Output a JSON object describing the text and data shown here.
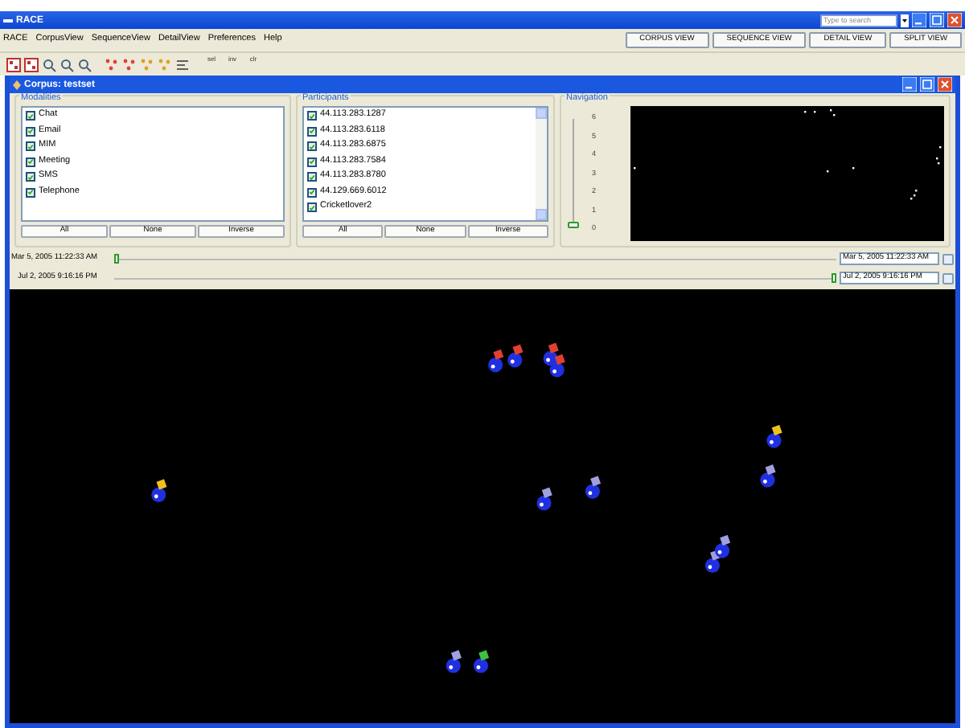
{
  "window": {
    "title": "RACE"
  },
  "search": {
    "placeholder": "Type to search"
  },
  "menu": [
    "RACE",
    "CorpusView",
    "SequenceView",
    "DetailView",
    "Preferences",
    "Help"
  ],
  "view_buttons": [
    "CORPUS VIEW",
    "SEQUENCE VIEW",
    "DETAIL VIEW",
    "SPLIT VIEW"
  ],
  "toolbar_labels": [
    "sel",
    "inv",
    "clr"
  ],
  "corpus_frame": {
    "title": "Corpus: testset"
  },
  "modalities": {
    "title": "Modalities",
    "items": [
      {
        "label": "Chat",
        "checked": true
      },
      {
        "label": "Email",
        "checked": true
      },
      {
        "label": "MIM",
        "checked": true
      },
      {
        "label": "Meeting",
        "checked": true
      },
      {
        "label": "SMS",
        "checked": true
      },
      {
        "label": "Telephone",
        "checked": true
      }
    ],
    "buttons": [
      "All",
      "None",
      "Inverse"
    ]
  },
  "participants": {
    "title": "Participants",
    "items": [
      {
        "label": "44.113.283.1287",
        "checked": true
      },
      {
        "label": "44.113.283.6118",
        "checked": true
      },
      {
        "label": "44.113.283.6875",
        "checked": true
      },
      {
        "label": "44.113.283.7584",
        "checked": true
      },
      {
        "label": "44.113.283.8780",
        "checked": true
      },
      {
        "label": "44.129.669.6012",
        "checked": true
      },
      {
        "label": "Cricketlover2",
        "checked": true
      }
    ],
    "buttons": [
      "All",
      "None",
      "Inverse"
    ]
  },
  "navigation": {
    "title": "Navigation",
    "scale": [
      "6",
      "5",
      "4",
      "3",
      "2",
      "1",
      "0"
    ],
    "level": 0
  },
  "time_range": [
    {
      "label": "Mar 5, 2005 11:22:33 AM",
      "field": "Mar 5, 2005 11:22:33 AM",
      "level": 0
    },
    {
      "label": "Jul 2, 2005 9:16:16 PM",
      "field": "Jul 2, 2005 9:16:16 PM",
      "level": 1
    }
  ]
}
